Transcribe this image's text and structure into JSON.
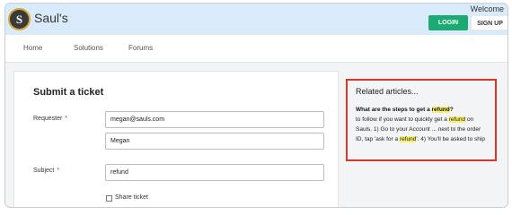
{
  "header": {
    "logo_letter": "S",
    "brand": "Saul's",
    "welcome": "Welcome",
    "login_label": "LOGIN",
    "signup_label": "SIGN UP"
  },
  "nav": {
    "items": [
      "Home",
      "Solutions",
      "Forums"
    ]
  },
  "form": {
    "title": "Submit a ticket",
    "requester_label": "Requester",
    "required_mark": "*",
    "email_value": "megan@sauls.com",
    "name_value": "Megan",
    "subject_label": "Subject",
    "subject_value": "refund",
    "share_label": "Share ticket"
  },
  "related": {
    "title": "Related articles...",
    "article_title_pre": "What are the steps to get a ",
    "keyword": "refund",
    "article_title_post": "?",
    "line1_pre": "to follow if you want to quickly get a ",
    "line1_post": " on",
    "line2": "Sauls. 1) Go to your Account ... next to the order",
    "line3_pre": "ID, tap 'ask for a ",
    "line3_post": "'. 4) You'll be asked to ship"
  },
  "colors": {
    "header_bg": "#d9ebfa",
    "login_bg": "#1aaa72",
    "highlight_border": "#e03424",
    "keyword_highlight": "#f7f06d",
    "required": "#e0223a"
  }
}
